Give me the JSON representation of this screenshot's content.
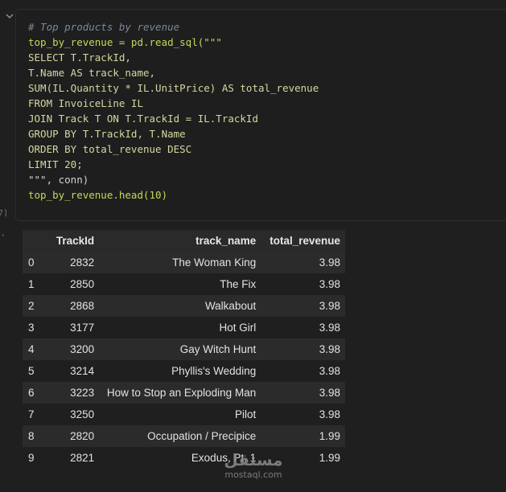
{
  "cell": {
    "exec_count": "7]",
    "output_prompt": "·",
    "code_lines": [
      "# Top products by revenue",
      "top_by_revenue = pd.read_sql(\"\"\"",
      "SELECT T.TrackId,",
      "T.Name AS track_name,",
      "SUM(IL.Quantity * IL.UnitPrice) AS total_revenue",
      "FROM InvoiceLine IL",
      "JOIN Track T ON T.TrackId = IL.TrackId",
      "GROUP BY T.TrackId, T.Name",
      "ORDER BY total_revenue DESC",
      "LIMIT 20;",
      "\"\"\", conn)",
      "top_by_revenue.head(10)"
    ]
  },
  "table": {
    "columns": [
      "",
      "TrackId",
      "track_name",
      "total_revenue"
    ],
    "rows": [
      [
        "0",
        "2832",
        "The Woman King",
        "3.98"
      ],
      [
        "1",
        "2850",
        "The Fix",
        "3.98"
      ],
      [
        "2",
        "2868",
        "Walkabout",
        "3.98"
      ],
      [
        "3",
        "3177",
        "Hot Girl",
        "3.98"
      ],
      [
        "4",
        "3200",
        "Gay Witch Hunt",
        "3.98"
      ],
      [
        "5",
        "3214",
        "Phyllis's Wedding",
        "3.98"
      ],
      [
        "6",
        "3223",
        "How to Stop an Exploding Man",
        "3.98"
      ],
      [
        "7",
        "3250",
        "Pilot",
        "3.98"
      ],
      [
        "8",
        "2820",
        "Occupation / Precipice",
        "1.99"
      ],
      [
        "9",
        "2821",
        "Exodus, Pt. 1",
        "1.99"
      ]
    ]
  },
  "watermark": {
    "arabic": "مستقل",
    "latin": "mostaql.com"
  },
  "icons": {
    "collapse": "chevron-down-icon"
  }
}
